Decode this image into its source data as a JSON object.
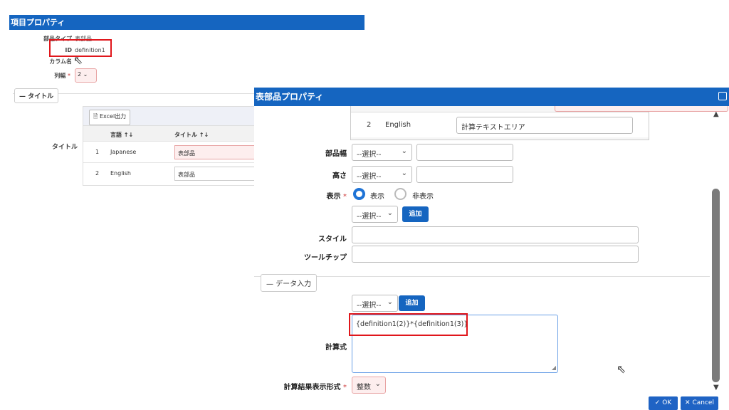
{
  "background_panel": {
    "title": "項目プロパティ",
    "fields": {
      "part_type_label": "部品タイプ",
      "part_type_value": "表部品",
      "id_label": "ID",
      "id_value": "definition1",
      "column_name_label": "カラム名",
      "column_width_label": "列幅",
      "required_mark": "*",
      "column_width_value": "2"
    },
    "title_section": {
      "tab_label": "タイトル",
      "row_label": "タイトル",
      "excel_button": "Excel出力",
      "columns": [
        "言語 ↑↓",
        "タイトル ↑↓"
      ],
      "rows": [
        {
          "no": "1",
          "language": "Japanese",
          "title": "表部品"
        },
        {
          "no": "2",
          "language": "English",
          "title": "表部品"
        }
      ]
    }
  },
  "dialog": {
    "title": "表部品プロパティ",
    "table_row": {
      "no": "2",
      "language": "English",
      "value": "計算テキストエリア"
    },
    "part_width": {
      "label": "部品幅",
      "select": "--選択--"
    },
    "height": {
      "label": "高さ",
      "select": "--選択--"
    },
    "display": {
      "label": "表示",
      "required_mark": "*",
      "options": [
        "表示",
        "非表示"
      ],
      "selected": "表示",
      "select": "--選択--",
      "add_button": "追加"
    },
    "style": {
      "label": "スタイル"
    },
    "tooltip": {
      "label": "ツールチップ"
    },
    "data_input_section": {
      "tab_label": "データ入力",
      "select": "--選択--",
      "add_button": "追加",
      "formula_label": "計算式",
      "formula_value": "{definition1(2)}*{definition1(3)}",
      "result_format_label": "計算結果表示形式",
      "required_mark": "*",
      "result_format_value": "整数"
    },
    "footer": {
      "ok_label": "OK",
      "cancel_label": "Cancel"
    }
  },
  "colors": {
    "titlebar": "#1565c0",
    "highlight_box": "#e0161b",
    "radio_selected": "#1e73d6",
    "required_field_bg": "#fdeeee"
  }
}
